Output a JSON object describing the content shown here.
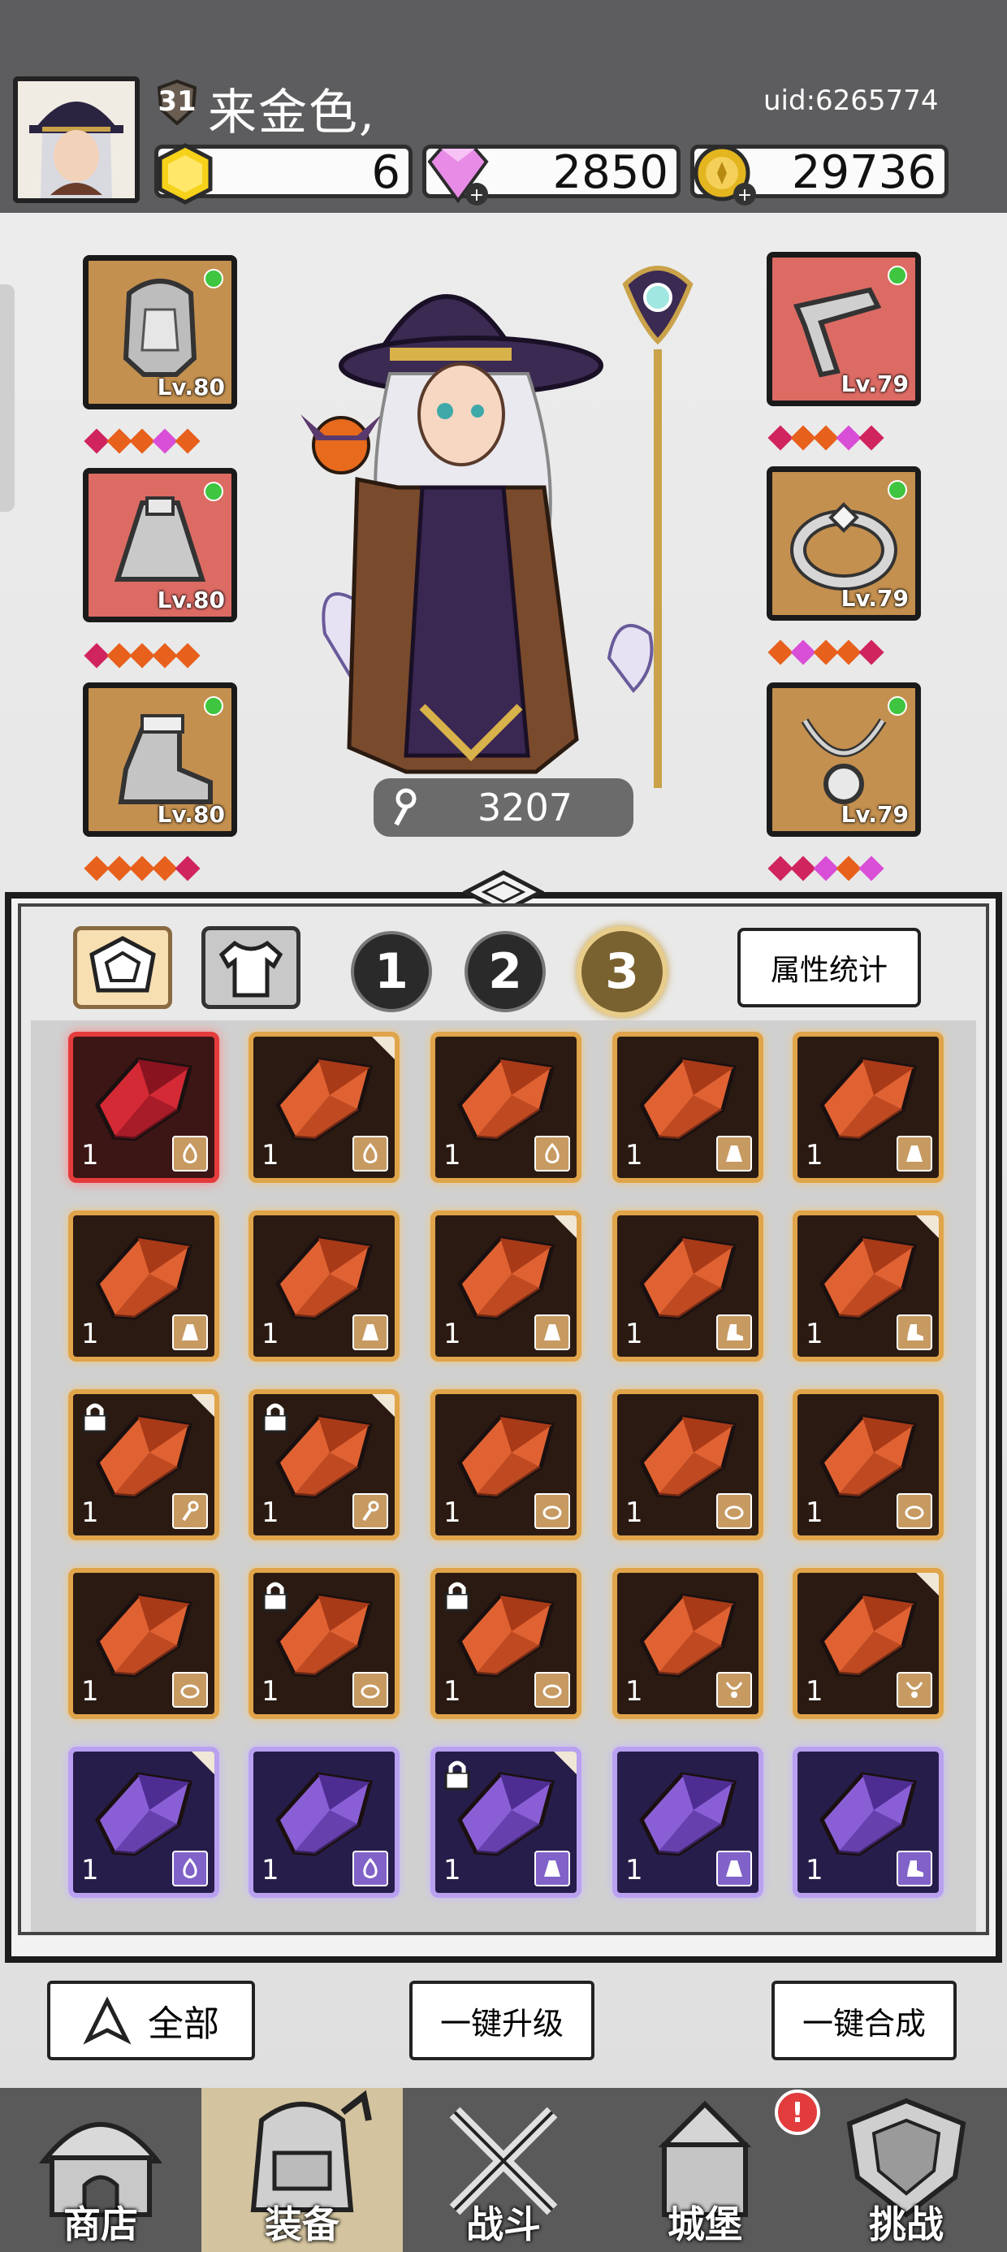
{
  "player": {
    "level": "31",
    "name": "来金色,",
    "uid": "uid:6265774"
  },
  "currency": {
    "gold_bars": "6",
    "diamonds": "2850",
    "coins": "29736"
  },
  "equipment": {
    "left": [
      {
        "level": "Lv.80"
      },
      {
        "level": "Lv.80"
      },
      {
        "level": "Lv.80"
      }
    ],
    "right": [
      {
        "level": "Lv.79"
      },
      {
        "level": "Lv.79"
      },
      {
        "level": "Lv.79"
      }
    ]
  },
  "power": "3207",
  "tabs": {
    "numbers": [
      "1",
      "2",
      "3"
    ],
    "selected": "3",
    "stats_button": "属性统计"
  },
  "inventory_counts": [
    "1",
    "1",
    "1",
    "1",
    "1",
    "1",
    "1",
    "1",
    "1",
    "1",
    "1",
    "1",
    "1",
    "1",
    "1",
    "1",
    "1",
    "1",
    "1",
    "1",
    "1",
    "1",
    "1",
    "1",
    "1"
  ],
  "actions": {
    "filter": "全部",
    "upgrade_all": "一键升级",
    "merge_all": "一键合成"
  },
  "nav": [
    "商店",
    "装备",
    "战斗",
    "城堡",
    "挑战"
  ],
  "colors": {
    "gold_frame": "#e0a44a",
    "purple_frame": "#b9a1f0",
    "selected_frame": "#e43c3c",
    "nav_bg": "#5a5a5a"
  }
}
